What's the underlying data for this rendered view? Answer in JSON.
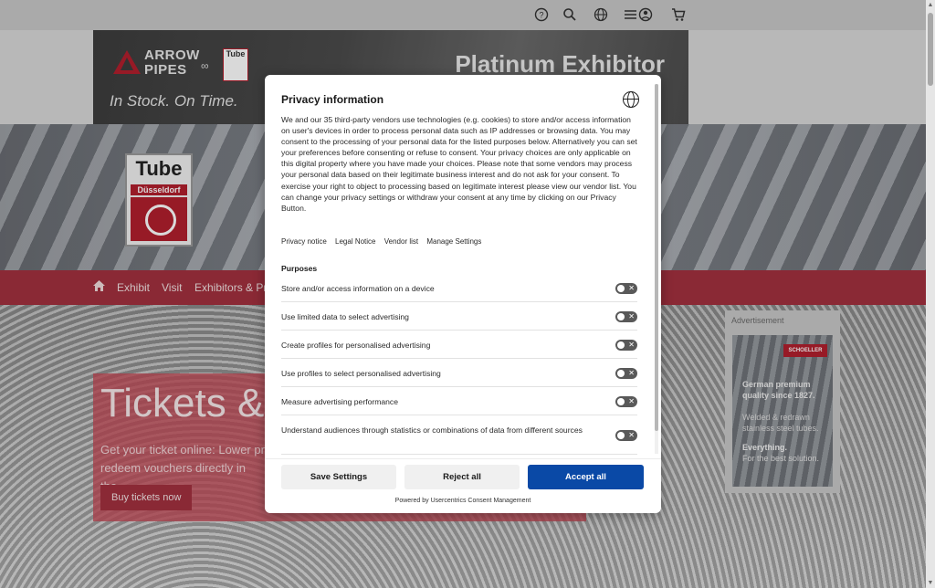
{
  "topbar": {
    "icons": [
      "help-icon",
      "search-icon",
      "globe-icon",
      "menu-account-icon",
      "cart-icon"
    ]
  },
  "banner": {
    "brand_line1": "ARROW",
    "brand_line2": "PIPES",
    "mini_logo": "Tube",
    "slogan": "In Stock. On Time.",
    "platinum": "Platinum Exhibitor"
  },
  "site_logo": {
    "title": "Tube",
    "subtitle": "Düsseldorf"
  },
  "nav": {
    "items": [
      "Exhibit",
      "Visit",
      "Exhibitors & Pr"
    ]
  },
  "tickets": {
    "heading": "Tickets &",
    "text": "Get your ticket online: Lower pr redeem vouchers directly in the",
    "button": "Buy tickets now"
  },
  "ad": {
    "label": "Advertisement",
    "brand": "SCHOELLER",
    "line1": "German premium quality since 1827.",
    "line2": "Welded & redrawn stainless steel tubes.",
    "line3": "Everything.",
    "line4": "For the best solution."
  },
  "consent": {
    "title": "Privacy information",
    "description": "We and our 35 third-party vendors use technologies (e.g. cookies) to store and/or access information on user's devices in order to process personal data such as IP addresses or browsing data. You may consent to the processing of your personal data for the listed purposes below. Alternatively you can set your preferences before consenting or refuse to consent. Your privacy choices are only applicable on this digital property where you have made your choices. Please note that some vendors may process your personal data based on their legitimate business interest and do not ask for your consent. To exercise your right to object to processing based on legitimate interest please view our vendor list. You can change your privacy settings or withdraw your consent at any time by clicking on our Privacy Button.",
    "links": [
      "Privacy notice",
      "Legal Notice",
      "Vendor list",
      "Manage Settings"
    ],
    "purposes_heading": "Purposes",
    "purposes": [
      "Store and/or access information on a device",
      "Use limited data to select advertising",
      "Create profiles for personalised advertising",
      "Use profiles to select personalised advertising",
      "Measure advertising performance",
      "Understand audiences through statistics or combinations of data from different sources"
    ],
    "buttons": {
      "save": "Save Settings",
      "reject": "Reject all",
      "accept": "Accept all"
    },
    "powered": "Powered by Usercentrics Consent Management"
  }
}
